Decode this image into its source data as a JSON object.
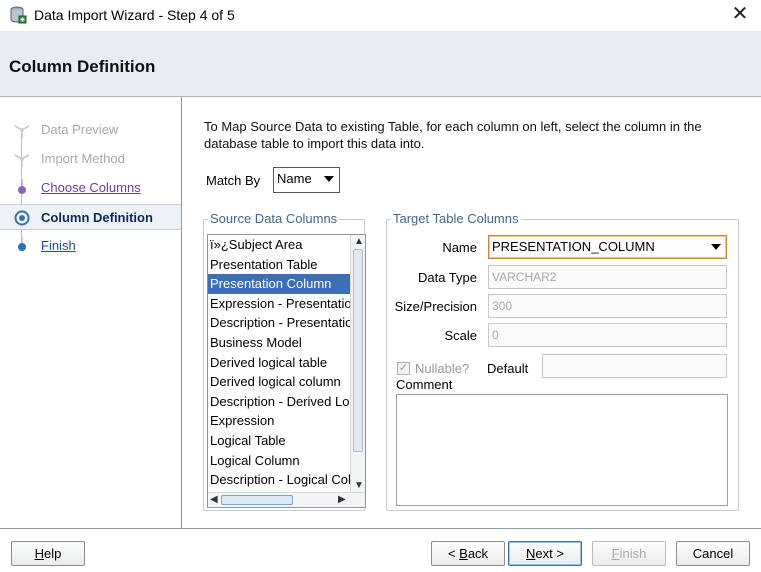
{
  "window": {
    "title": "Data Import Wizard - Step 4 of 5",
    "close_glyph": "✕"
  },
  "header": {
    "title": "Column Definition"
  },
  "sidebar": {
    "steps": [
      {
        "label": "Data Preview",
        "state": "done"
      },
      {
        "label": "Import Method",
        "state": "done"
      },
      {
        "label": "Choose Columns",
        "state": "visited"
      },
      {
        "label": "Column Definition",
        "state": "current"
      },
      {
        "label": "Finish",
        "state": "pending"
      }
    ]
  },
  "main": {
    "instruction": "To Map Source Data to existing Table, for each column on left, select the column in the database table to import this data into.",
    "match_by": {
      "label": "Match By",
      "value": "Name"
    },
    "source": {
      "title": "Source Data Columns",
      "items": [
        "ï»¿Subject Area",
        "Presentation Table",
        "Presentation Column",
        "Expression - Presentation Column",
        "Description - Presentation Column",
        "Business Model",
        "Derived logical table",
        "Derived logical column",
        "Description - Derived Logical Column",
        "Expression",
        "Logical Table",
        "Logical Column",
        "Description - Logical Column"
      ],
      "selected_index": 2
    },
    "target": {
      "title": "Target Table Columns",
      "name_label": "Name",
      "name_value": "PRESENTATION_COLUMN",
      "datatype_label": "Data Type",
      "datatype_value": "VARCHAR2",
      "size_label": "Size/Precision",
      "size_value": "300",
      "scale_label": "Scale",
      "scale_value": "0",
      "nullable_label": "Nullable?",
      "nullable_checked": true,
      "default_label": "Default",
      "default_value": "",
      "comment_label": "Comment",
      "comment_value": ""
    }
  },
  "footer": {
    "help": {
      "mnemonic": "H",
      "rest": "elp"
    },
    "back": {
      "prefix": "< ",
      "mnemonic": "B",
      "rest": "ack"
    },
    "next": {
      "mnemonic": "N",
      "rest": "ext >"
    },
    "finish": {
      "mnemonic": "F",
      "rest": "inish"
    },
    "cancel": "Cancel"
  },
  "colors": {
    "header_bg": "#e7edf3",
    "selection": "#3d6fb8",
    "group_title": "#44668c",
    "visited_link": "#6a3ea0",
    "link": "#1e4e9a"
  }
}
